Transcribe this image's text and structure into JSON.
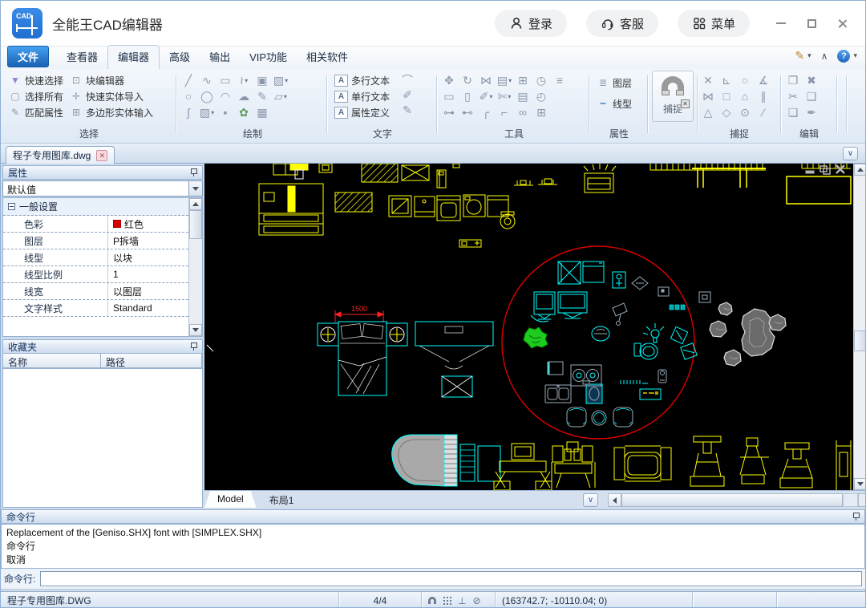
{
  "titlebar": {
    "app_title": "全能王CAD编辑器",
    "login_label": "登录",
    "support_label": "客服",
    "menu_label": "菜单"
  },
  "menubar": {
    "tabs": [
      "文件",
      "查看器",
      "编辑器",
      "高级",
      "输出",
      "VIP功能",
      "相关软件"
    ],
    "right": {
      "annotate": "✎",
      "collapse": "∧",
      "help": "?"
    }
  },
  "ribbon": {
    "select": {
      "label": "选择",
      "items": [
        {
          "label": "快速选择",
          "glyph": "▼"
        },
        {
          "label": "选择所有",
          "glyph": "▢"
        },
        {
          "label": "匹配属性",
          "glyph": "✎"
        },
        {
          "label": "块编辑器",
          "glyph": "⊡"
        },
        {
          "label": "快速实体导入",
          "glyph": "✛"
        },
        {
          "label": "多边形实体输入",
          "glyph": "⊞"
        }
      ]
    },
    "draw": {
      "label": "绘制",
      "icons": [
        {
          "name": "line",
          "glyph": "╱"
        },
        {
          "name": "polyline",
          "glyph": "∿"
        },
        {
          "name": "rectangle",
          "glyph": "▭"
        },
        {
          "name": "spline",
          "glyph": "≀"
        },
        {
          "name": "insert-block",
          "glyph": "▣"
        },
        {
          "name": "boundary",
          "glyph": "▧"
        },
        {
          "name": "circle",
          "glyph": "○"
        },
        {
          "name": "ellipse",
          "glyph": "◯"
        },
        {
          "name": "arc",
          "glyph": "◠"
        },
        {
          "name": "revision-cloud",
          "glyph": "☁"
        },
        {
          "name": "construction-line",
          "glyph": "✎"
        },
        {
          "name": "region",
          "glyph": "▱"
        },
        {
          "name": "s-spline",
          "glyph": "ʃ"
        },
        {
          "name": "hatch",
          "glyph": "▨"
        },
        {
          "name": "point",
          "glyph": "▪"
        },
        {
          "name": "image",
          "glyph": "✿"
        },
        {
          "name": "table",
          "glyph": "▦"
        }
      ]
    },
    "text": {
      "label": "文字",
      "items": [
        {
          "label": "多行文本",
          "glyph": "A"
        },
        {
          "label": "单行文本",
          "glyph": "A"
        },
        {
          "label": "属性定义",
          "glyph": "A"
        }
      ],
      "side_icons": [
        {
          "name": "arc-text",
          "glyph": "⌒"
        },
        {
          "name": "text-style",
          "glyph": "✐"
        },
        {
          "name": "edit-text",
          "glyph": "✎"
        }
      ]
    },
    "tools": {
      "label": "工具",
      "rows": [
        [
          {
            "name": "move",
            "glyph": "✥"
          },
          {
            "name": "rotate",
            "glyph": "↻"
          },
          {
            "name": "mirror",
            "glyph": "⋈"
          },
          {
            "name": "array",
            "glyph": "▤"
          },
          {
            "name": "copy",
            "glyph": "⊞"
          },
          {
            "name": "copy-time",
            "glyph": "◷"
          },
          {
            "name": "align",
            "glyph": "≡"
          }
        ],
        [
          {
            "name": "rect-tool",
            "glyph": "▭"
          },
          {
            "name": "base-point",
            "glyph": "▯"
          },
          {
            "name": "link",
            "glyph": "✐"
          },
          {
            "name": "trim",
            "glyph": "✄"
          },
          {
            "name": "duplicate",
            "glyph": "▤"
          },
          {
            "name": "clock-copy",
            "glyph": "◴"
          }
        ],
        [
          {
            "name": "offset",
            "glyph": "⊶"
          },
          {
            "name": "offset-2",
            "glyph": "⊷"
          },
          {
            "name": "fillet",
            "glyph": "╭"
          },
          {
            "name": "chamfer",
            "glyph": "⌐"
          },
          {
            "name": "group",
            "glyph": "∞"
          },
          {
            "name": "add-block",
            "glyph": "⊞"
          }
        ]
      ]
    },
    "props": {
      "label": "属性",
      "items": [
        {
          "label": "图层",
          "glyph": "≣"
        },
        {
          "label": "线型",
          "glyph": "┅"
        }
      ]
    },
    "snap_big": {
      "label": "捕捉"
    },
    "snap": {
      "label": "捕捉",
      "rows": [
        [
          {
            "name": "snap-endpoint",
            "glyph": "✕"
          },
          {
            "name": "snap-perpendicular",
            "glyph": "⊾"
          },
          {
            "name": "snap-center",
            "glyph": "○"
          },
          {
            "name": "snap-angle",
            "glyph": "∡"
          }
        ],
        [
          {
            "name": "snap-intersection",
            "glyph": "⋈"
          },
          {
            "name": "snap-node",
            "glyph": "□"
          },
          {
            "name": "snap-polygon",
            "glyph": "⌂"
          },
          {
            "name": "snap-parallel",
            "glyph": "∥"
          }
        ],
        [
          {
            "name": "snap-midpoint",
            "glyph": "△"
          },
          {
            "name": "snap-quadrant",
            "glyph": "◇"
          },
          {
            "name": "snap-tangent",
            "glyph": "⊙"
          },
          {
            "name": "snap-nearest",
            "glyph": "∕"
          }
        ]
      ]
    },
    "edit": {
      "label": "编辑",
      "rows": [
        [
          {
            "name": "paste",
            "glyph": "❐"
          },
          {
            "name": "delete",
            "glyph": "✖"
          }
        ],
        [
          {
            "name": "cut",
            "glyph": "✂"
          },
          {
            "name": "paste-special",
            "glyph": "❑"
          }
        ],
        [
          {
            "name": "copy-clip",
            "glyph": "❏"
          },
          {
            "name": "format-painter",
            "glyph": "✒"
          }
        ]
      ]
    }
  },
  "doc_tab": {
    "title": "程子专用图库.dwg"
  },
  "properties_panel": {
    "title": "属性",
    "preset": "默认值",
    "group_row": "一般设置",
    "rows": [
      {
        "label": "色彩",
        "value": "红色",
        "swatch": "#dd0000"
      },
      {
        "label": "图层",
        "value": "P拆墙"
      },
      {
        "label": "线型",
        "value": "以块"
      },
      {
        "label": "线型比例",
        "value": "1"
      },
      {
        "label": "线宽",
        "value": "以图层"
      },
      {
        "label": "文字样式",
        "value": "Standard"
      }
    ]
  },
  "favorites_panel": {
    "title": "收藏夹",
    "name_col": "名称",
    "path_col": "路径"
  },
  "canvas": {
    "dimension_label": "1500",
    "model_tab": "Model",
    "layout_tab": "布局1",
    "colors": {
      "yellow": "#ffff00",
      "cyan": "#00ffff",
      "red": "#dd0000",
      "green": "#1ecb1e"
    }
  },
  "command_panel": {
    "title": "命令行",
    "log_lines": [
      "Replacement of the [Geniso.SHX] font with [SIMPLEX.SHX]",
      "命令行",
      "取消"
    ],
    "prompt": "命令行:",
    "input_value": ""
  },
  "statusbar": {
    "file_name": "程子专用图库.DWG",
    "count": "4/4",
    "coords": "(163742.7; -10110.04; 0)",
    "icons": {
      "perpendicular": "⊥",
      "ortho": "⊘"
    }
  }
}
